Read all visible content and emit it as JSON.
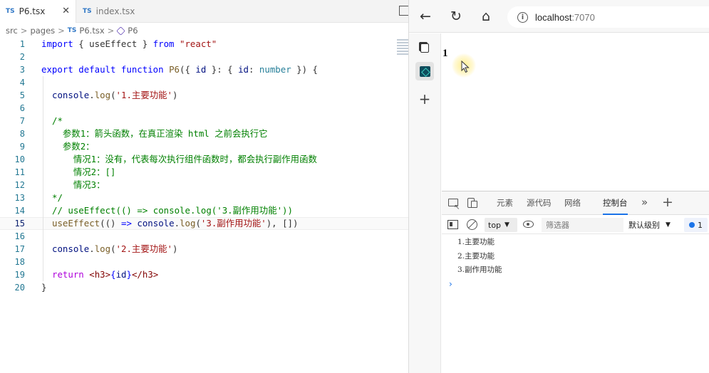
{
  "editor": {
    "tabs": [
      {
        "badge": "TS",
        "label": "P6.tsx",
        "close": "✕"
      },
      {
        "badge": "TS",
        "label": "index.tsx"
      }
    ],
    "breadcrumb": {
      "seg1": "src",
      "seg2": "pages",
      "badge": "TS",
      "file": "P6.tsx",
      "symbol": "P6",
      "sep": ">"
    },
    "lines": [
      {
        "n": "1",
        "indent": 0,
        "segs": [
          [
            "import",
            "kw"
          ],
          [
            " { useEffect } ",
            "p"
          ],
          [
            "from",
            "kw"
          ],
          [
            " ",
            "p"
          ],
          [
            "\"react\"",
            "str"
          ]
        ]
      },
      {
        "n": "2",
        "indent": 0,
        "segs": []
      },
      {
        "n": "3",
        "indent": 0,
        "segs": [
          [
            "export",
            "kw"
          ],
          [
            " ",
            "p"
          ],
          [
            "default",
            "kw"
          ],
          [
            " ",
            "p"
          ],
          [
            "function",
            "kw"
          ],
          [
            " ",
            "p"
          ],
          [
            "P6",
            "fn"
          ],
          [
            "({ ",
            "p"
          ],
          [
            "id",
            "var"
          ],
          [
            " }: { ",
            "p"
          ],
          [
            "id",
            "var"
          ],
          [
            ": ",
            "p"
          ],
          [
            "number",
            "ty"
          ],
          [
            " }) {",
            "p"
          ]
        ]
      },
      {
        "n": "4",
        "indent": 1,
        "segs": []
      },
      {
        "n": "5",
        "indent": 1,
        "segs": [
          [
            "console",
            "var"
          ],
          [
            ".",
            "p"
          ],
          [
            "log",
            "fn"
          ],
          [
            "(",
            "p"
          ],
          [
            "'1.主要功能'",
            "str"
          ],
          [
            ")",
            "p"
          ]
        ]
      },
      {
        "n": "6",
        "indent": 1,
        "segs": []
      },
      {
        "n": "7",
        "indent": 1,
        "segs": [
          [
            "/*",
            "cm"
          ]
        ]
      },
      {
        "n": "8",
        "indent": 1,
        "segs": [
          [
            "  参数1：箭头函数，在真正渲染 ",
            "cm"
          ],
          [
            "html",
            "cmk"
          ],
          [
            " 之前会执行它",
            "cm"
          ]
        ]
      },
      {
        "n": "9",
        "indent": 1,
        "segs": [
          [
            "  参数2：",
            "cm"
          ]
        ]
      },
      {
        "n": "10",
        "indent": 1,
        "segs": [
          [
            "    情况1：没有，代表每次执行组件函数时，都会执行副作用函数",
            "cm"
          ]
        ]
      },
      {
        "n": "11",
        "indent": 1,
        "segs": [
          [
            "    情况2：[]",
            "cm"
          ]
        ]
      },
      {
        "n": "12",
        "indent": 1,
        "segs": [
          [
            "    情况3：",
            "cm"
          ]
        ]
      },
      {
        "n": "13",
        "indent": 1,
        "segs": [
          [
            "*/",
            "cm"
          ]
        ]
      },
      {
        "n": "14",
        "indent": 1,
        "segs": [
          [
            "// useEffect(() => console.log('3.副作用功能'))",
            "cm"
          ]
        ]
      },
      {
        "n": "15",
        "indent": 1,
        "current": true,
        "segs": [
          [
            "useEffect",
            "fn"
          ],
          [
            "(() ",
            "p"
          ],
          [
            "=>",
            "kw"
          ],
          [
            " ",
            "p"
          ],
          [
            "console",
            "var"
          ],
          [
            ".",
            "p"
          ],
          [
            "log",
            "fn"
          ],
          [
            "(",
            "p"
          ],
          [
            "'3.副作用功能'",
            "str"
          ],
          [
            "), [])",
            "p"
          ]
        ]
      },
      {
        "n": "16",
        "indent": 1,
        "segs": []
      },
      {
        "n": "17",
        "indent": 1,
        "segs": [
          [
            "console",
            "var"
          ],
          [
            ".",
            "p"
          ],
          [
            "log",
            "fn"
          ],
          [
            "(",
            "p"
          ],
          [
            "'2.主要功能'",
            "str"
          ],
          [
            ")",
            "p"
          ]
        ]
      },
      {
        "n": "18",
        "indent": 1,
        "segs": []
      },
      {
        "n": "19",
        "indent": 1,
        "segs": [
          [
            "return",
            "kw2"
          ],
          [
            " ",
            "p"
          ],
          [
            "<",
            "tg"
          ],
          [
            "h3",
            "tg"
          ],
          [
            ">",
            "tg"
          ],
          [
            "{",
            "kw"
          ],
          [
            "id",
            "var"
          ],
          [
            "}",
            "kw"
          ],
          [
            "</",
            "tg"
          ],
          [
            "h3",
            "tg"
          ],
          [
            ">",
            "tg"
          ]
        ]
      },
      {
        "n": "20",
        "indent": 0,
        "segs": [
          [
            "}",
            "p"
          ]
        ]
      }
    ]
  },
  "syntax_colors": {
    "kw": "#0000ff",
    "kw2": "#af00db",
    "fn": "#795e26",
    "var": "#001080",
    "ty": "#267f99",
    "str": "#a31515",
    "cm": "#008000",
    "cmk": "#008000",
    "p": "#333333",
    "tg": "#800000"
  },
  "browser": {
    "back_icon": "←",
    "reload_icon": "↻",
    "home_icon": "⌂",
    "info_icon": "i",
    "address_host": "localhost",
    "address_port": ":7070",
    "sidebar_plus": "+",
    "page_output": "1",
    "devtools": {
      "tabs": [
        "元素",
        "源代码",
        "网络",
        "控制台"
      ],
      "active_tab": "控制台",
      "more": "»",
      "add": "+",
      "context": "top",
      "caret": "▼",
      "filter_placeholder": "筛选器",
      "level": "默认级别",
      "issues": "1",
      "logs": [
        "1.主要功能",
        "2.主要功能",
        "3.副作用功能"
      ],
      "prompt": "›"
    }
  }
}
